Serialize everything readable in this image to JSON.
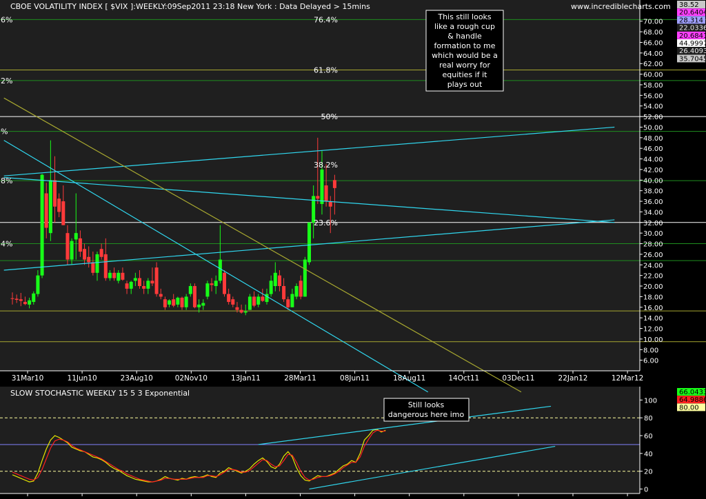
{
  "colors": {
    "background": "#000000",
    "panel": "#1f1f1f",
    "axis": "#ffffff",
    "grid": "#1f8f1f",
    "up": "#18ff18",
    "down": "#ff3a3a",
    "cyan": "#30d8f0",
    "olive": "#a8a830",
    "white_line": "#ffffff",
    "stoch_k": "#e8e800",
    "stoch_d": "#ff2020",
    "yellow_dash": "#ffffa0",
    "purple_line": "#8080ff"
  },
  "header": {
    "title": "CBOE VOLATILITY INDEX [ $VIX ]:WEEKLY:09Sep2011 23:18 New York  : Data Delayed > 15mins",
    "website": "www.incrediblecharts.com"
  },
  "price_badges": [
    {
      "text": "38.52",
      "bg": "#c8c8c8",
      "fg": "#000000"
    },
    {
      "text": "20.6404",
      "bg": "#ff40ff",
      "fg": "#000000"
    },
    {
      "text": "28.314",
      "bg": "#a0a0ff",
      "fg": "#000000"
    },
    {
      "text": "22.0336",
      "bg": "#1f1f1f",
      "fg": "#e8e8e8"
    },
    {
      "text": "20.6841",
      "bg": "#ff40ff",
      "fg": "#000000"
    },
    {
      "text": "44.9997",
      "bg": "#ffffff",
      "fg": "#000000"
    },
    {
      "text": "26.4093",
      "bg": "#1f1f1f",
      "fg": "#e8e8e8"
    },
    {
      "text": "35.7045",
      "bg": "#c8c8c8",
      "fg": "#000000"
    }
  ],
  "stoch_badges": [
    {
      "text": "66.0433",
      "bg": "#18ff18",
      "fg": "#000000"
    },
    {
      "text": "64.9886",
      "bg": "#ff2020",
      "fg": "#000000"
    },
    {
      "text": "80.00",
      "bg": "#ffffa0",
      "fg": "#000000"
    }
  ],
  "left_edge_labels": [
    {
      "text": "6%",
      "value": 70.3
    },
    {
      "text": "2%",
      "value": 58.8
    },
    {
      "text": "%",
      "value": 49.2
    },
    {
      "text": "8%",
      "value": 39.9
    },
    {
      "text": "4%",
      "value": 28.0
    }
  ],
  "annotations": {
    "cup_handle": [
      "This still looks",
      "like a rough cup",
      "& handle",
      "formation to me",
      "which would be a",
      "real worry for",
      "equities if it",
      "plays out"
    ],
    "dangerous": [
      "Still looks",
      "dangerous here imo"
    ]
  },
  "chart_data": [
    {
      "type": "candlestick",
      "title": "CBOE VOLATILITY INDEX [ $VIX ]:WEEKLY:09Sep2011 23:18 New York  : Data Delayed > 15mins",
      "ylim": [
        4,
        74
      ],
      "y_ticks": [
        6,
        8,
        10,
        12,
        14,
        16,
        18,
        20,
        22,
        24,
        26,
        28,
        30,
        32,
        34,
        36,
        38,
        40,
        42,
        44,
        46,
        48,
        50,
        52,
        54,
        56,
        58,
        60,
        62,
        64,
        66,
        68,
        70
      ],
      "x_ticks": [
        "31Mar10",
        "11Jun10",
        "23Aug10",
        "02Nov10",
        "13Jan11",
        "28Mar11",
        "08Jun11",
        "18Aug11",
        "14Oct11",
        "03Dec11",
        "22Jan12",
        "12Mar12"
      ],
      "fib_levels": [
        {
          "label": "76.4%",
          "value": 70.3
        },
        {
          "label": "61.8%",
          "value": 60.8
        },
        {
          "label": "50%",
          "value": 52.0
        },
        {
          "label": "38.2%",
          "value": 42.9
        },
        {
          "label": "23.6%",
          "value": 32.0
        }
      ],
      "horizontal_lines": [
        {
          "value": 70.3,
          "color": "grid"
        },
        {
          "value": 58.8,
          "color": "grid"
        },
        {
          "value": 49.2,
          "color": "grid"
        },
        {
          "value": 39.9,
          "color": "grid"
        },
        {
          "value": 28.0,
          "color": "grid"
        },
        {
          "value": 24.8,
          "color": "grid"
        },
        {
          "value": 15.3,
          "color": "olive"
        },
        {
          "value": 9.5,
          "color": "olive"
        },
        {
          "value": 60.8,
          "color": "olive"
        },
        {
          "value": 52.0,
          "color": "white_line"
        },
        {
          "value": 32.0,
          "color": "white_line"
        }
      ],
      "candles": [
        {
          "o": 17.7,
          "h": 18.8,
          "l": 16.5,
          "c": 17.6
        },
        {
          "o": 17.6,
          "h": 18.4,
          "l": 16.8,
          "c": 17.4
        },
        {
          "o": 17.5,
          "h": 18.7,
          "l": 16.2,
          "c": 17.2
        },
        {
          "o": 17.0,
          "h": 18.0,
          "l": 16.4,
          "c": 16.6
        },
        {
          "o": 16.5,
          "h": 17.8,
          "l": 15.8,
          "c": 17.3
        },
        {
          "o": 17.0,
          "h": 19.0,
          "l": 16.5,
          "c": 18.6
        },
        {
          "o": 18.5,
          "h": 23.0,
          "l": 18.0,
          "c": 22.0
        },
        {
          "o": 22.0,
          "h": 41.2,
          "l": 21.5,
          "c": 41.0
        },
        {
          "o": 37.5,
          "h": 39.5,
          "l": 29.0,
          "c": 31.0
        },
        {
          "o": 30.0,
          "h": 47.5,
          "l": 28.5,
          "c": 40.0
        },
        {
          "o": 40.0,
          "h": 44.5,
          "l": 32.0,
          "c": 35.0
        },
        {
          "o": 36.5,
          "h": 37.5,
          "l": 33.0,
          "c": 34.0
        },
        {
          "o": 36.0,
          "h": 39.0,
          "l": 31.5,
          "c": 31.5
        },
        {
          "o": 30.0,
          "h": 31.5,
          "l": 24.0,
          "c": 25.0
        },
        {
          "o": 25.0,
          "h": 29.0,
          "l": 24.0,
          "c": 28.5
        },
        {
          "o": 28.8,
          "h": 37.5,
          "l": 25.0,
          "c": 30.0
        },
        {
          "o": 29.0,
          "h": 30.5,
          "l": 25.5,
          "c": 26.5
        },
        {
          "o": 27.0,
          "h": 28.0,
          "l": 24.0,
          "c": 25.0
        },
        {
          "o": 25.5,
          "h": 27.5,
          "l": 23.5,
          "c": 24.5
        },
        {
          "o": 24.5,
          "h": 26.5,
          "l": 22.0,
          "c": 22.5
        },
        {
          "o": 22.5,
          "h": 26.5,
          "l": 21.0,
          "c": 26.0
        },
        {
          "o": 27.0,
          "h": 28.0,
          "l": 25.0,
          "c": 25.5
        },
        {
          "o": 26.0,
          "h": 29.0,
          "l": 21.0,
          "c": 21.5
        },
        {
          "o": 21.5,
          "h": 23.0,
          "l": 21.0,
          "c": 22.5
        },
        {
          "o": 22.5,
          "h": 23.5,
          "l": 21.0,
          "c": 21.5
        },
        {
          "o": 21.0,
          "h": 23.0,
          "l": 20.5,
          "c": 22.5
        },
        {
          "o": 22.5,
          "h": 23.5,
          "l": 21.0,
          "c": 21.2
        },
        {
          "o": 20.5,
          "h": 21.0,
          "l": 18.5,
          "c": 19.5
        },
        {
          "o": 19.5,
          "h": 21.0,
          "l": 18.5,
          "c": 20.8
        },
        {
          "o": 21.0,
          "h": 22.5,
          "l": 20.0,
          "c": 21.5
        },
        {
          "o": 21.5,
          "h": 23.0,
          "l": 19.5,
          "c": 20.0
        },
        {
          "o": 20.0,
          "h": 21.0,
          "l": 18.5,
          "c": 19.5
        },
        {
          "o": 19.5,
          "h": 21.5,
          "l": 18.5,
          "c": 21.0
        },
        {
          "o": 21.0,
          "h": 23.5,
          "l": 20.0,
          "c": 20.5
        },
        {
          "o": 23.5,
          "h": 24.5,
          "l": 18.0,
          "c": 18.5
        },
        {
          "o": 18.5,
          "h": 19.5,
          "l": 17.5,
          "c": 18.0
        },
        {
          "o": 17.5,
          "h": 18.0,
          "l": 15.5,
          "c": 16.0
        },
        {
          "o": 16.5,
          "h": 17.5,
          "l": 16.0,
          "c": 17.3
        },
        {
          "o": 17.5,
          "h": 18.5,
          "l": 16.0,
          "c": 16.3
        },
        {
          "o": 16.5,
          "h": 18.0,
          "l": 16.0,
          "c": 17.8
        },
        {
          "o": 17.8,
          "h": 18.0,
          "l": 15.5,
          "c": 16.0
        },
        {
          "o": 16.0,
          "h": 18.5,
          "l": 15.5,
          "c": 18.0
        },
        {
          "o": 18.5,
          "h": 20.5,
          "l": 18.0,
          "c": 20.0
        },
        {
          "o": 20.0,
          "h": 20.5,
          "l": 15.8,
          "c": 16.0
        },
        {
          "o": 16.0,
          "h": 17.5,
          "l": 15.0,
          "c": 16.5
        },
        {
          "o": 16.3,
          "h": 17.5,
          "l": 15.5,
          "c": 16.8
        },
        {
          "o": 18.0,
          "h": 21.0,
          "l": 17.5,
          "c": 20.5
        },
        {
          "o": 20.5,
          "h": 21.5,
          "l": 19.0,
          "c": 20.2
        },
        {
          "o": 20.0,
          "h": 22.0,
          "l": 18.5,
          "c": 21.0
        },
        {
          "o": 21.0,
          "h": 31.5,
          "l": 20.5,
          "c": 25.0
        },
        {
          "o": 22.5,
          "h": 23.0,
          "l": 18.0,
          "c": 18.5
        },
        {
          "o": 18.5,
          "h": 19.5,
          "l": 16.5,
          "c": 17.0
        },
        {
          "o": 17.5,
          "h": 18.0,
          "l": 16.0,
          "c": 16.5
        },
        {
          "o": 16.0,
          "h": 17.0,
          "l": 15.0,
          "c": 15.5
        },
        {
          "o": 15.5,
          "h": 16.5,
          "l": 14.8,
          "c": 15.0
        },
        {
          "o": 15.0,
          "h": 16.5,
          "l": 14.5,
          "c": 15.2
        },
        {
          "o": 15.5,
          "h": 18.5,
          "l": 15.5,
          "c": 18.0
        },
        {
          "o": 18.0,
          "h": 19.0,
          "l": 16.0,
          "c": 16.3
        },
        {
          "o": 16.5,
          "h": 18.5,
          "l": 16.0,
          "c": 18.0
        },
        {
          "o": 18.0,
          "h": 19.5,
          "l": 17.0,
          "c": 17.2
        },
        {
          "o": 17.0,
          "h": 19.5,
          "l": 16.5,
          "c": 18.5
        },
        {
          "o": 18.5,
          "h": 22.0,
          "l": 18.0,
          "c": 21.0
        },
        {
          "o": 20.0,
          "h": 24.5,
          "l": 19.0,
          "c": 22.5
        },
        {
          "o": 22.0,
          "h": 23.0,
          "l": 19.0,
          "c": 20.0
        },
        {
          "o": 20.0,
          "h": 21.5,
          "l": 17.0,
          "c": 17.5
        },
        {
          "o": 17.5,
          "h": 18.0,
          "l": 15.5,
          "c": 16.0
        },
        {
          "o": 16.0,
          "h": 19.5,
          "l": 16.0,
          "c": 18.5
        },
        {
          "o": 18.0,
          "h": 20.5,
          "l": 17.5,
          "c": 20.0
        },
        {
          "o": 21.0,
          "h": 22.0,
          "l": 17.5,
          "c": 18.0
        },
        {
          "o": 18.0,
          "h": 25.5,
          "l": 18.0,
          "c": 25.0
        },
        {
          "o": 24.5,
          "h": 32.0,
          "l": 24.0,
          "c": 32.0
        },
        {
          "o": 32.0,
          "h": 39.0,
          "l": 29.0,
          "c": 37.0
        },
        {
          "o": 37.0,
          "h": 48.0,
          "l": 35.5,
          "c": 36.5
        },
        {
          "o": 35.5,
          "h": 45.5,
          "l": 33.5,
          "c": 42.0
        },
        {
          "o": 39.0,
          "h": 43.0,
          "l": 35.0,
          "c": 36.0
        },
        {
          "o": 36.0,
          "h": 37.0,
          "l": 30.0,
          "c": 35.0
        },
        {
          "o": 40.0,
          "h": 41.0,
          "l": 33.5,
          "c": 38.5
        }
      ],
      "trendlines": [
        {
          "color": "cyan",
          "from": {
            "i": -2,
            "v": 40.5
          },
          "to": {
            "i": 142,
            "v": 32.0
          },
          "note": "upper cyan through lows"
        },
        {
          "color": "cyan",
          "from": {
            "i": -2,
            "v": 23.0
          },
          "to": {
            "i": 142,
            "v": 32.5
          }
        },
        {
          "color": "cyan",
          "from": {
            "i": -2,
            "v": 40.8
          },
          "to": {
            "i": 142,
            "v": 50.0
          }
        },
        {
          "color": "cyan",
          "from": {
            "i": -2,
            "v": 47.5
          },
          "to": {
            "i": 98,
            "v": 0.0
          }
        },
        {
          "color": "olive",
          "from": {
            "i": -2,
            "v": 55.5
          },
          "to": {
            "i": 120,
            "v": 0.0
          }
        }
      ]
    },
    {
      "type": "line",
      "title": "SLOW STOCHASTIC WEEKLY 15 5 3 Exponential",
      "ylim": [
        -5,
        115
      ],
      "y_ticks": [
        0,
        20,
        40,
        60,
        80,
        100
      ],
      "levels": [
        {
          "value": 80,
          "color": "yellow_dash"
        },
        {
          "value": 50,
          "color": "purple_line"
        },
        {
          "value": 20,
          "color": "yellow_dash"
        }
      ],
      "series": [
        {
          "color": "stoch_k",
          "values": [
            16,
            14,
            12,
            10,
            8,
            9,
            18,
            32,
            45,
            55,
            60,
            58,
            55,
            52,
            47,
            45,
            43,
            42,
            39,
            36,
            35,
            33,
            30,
            26,
            23,
            21,
            18,
            15,
            13,
            11,
            10,
            9,
            8,
            8,
            9,
            11,
            14,
            12,
            11,
            10,
            12,
            11,
            13,
            14,
            13,
            14,
            16,
            14,
            13,
            18,
            20,
            24,
            22,
            20,
            18,
            20,
            23,
            28,
            32,
            35,
            31,
            25,
            23,
            28,
            37,
            42,
            36,
            24,
            15,
            10,
            9,
            12,
            15,
            14,
            14,
            16,
            18,
            22,
            26,
            28,
            32,
            30,
            40,
            55,
            60,
            66,
            67,
            64,
            66
          ]
        },
        {
          "color": "stoch_d",
          "values": [
            19,
            17,
            15,
            13,
            11,
            10,
            13,
            22,
            34,
            46,
            54,
            56,
            55,
            53,
            49,
            46,
            44,
            42,
            40,
            38,
            36,
            34,
            31,
            28,
            25,
            22,
            20,
            17,
            15,
            13,
            11,
            10,
            9,
            8,
            9,
            10,
            12,
            12,
            11,
            11,
            11,
            11,
            12,
            13,
            13,
            13,
            15,
            15,
            14,
            16,
            19,
            22,
            22,
            21,
            19,
            19,
            21,
            25,
            29,
            33,
            32,
            28,
            25,
            26,
            32,
            39,
            38,
            30,
            20,
            13,
            10,
            11,
            13,
            14,
            14,
            15,
            17,
            20,
            24,
            27,
            30,
            30,
            36,
            48,
            56,
            63,
            66,
            65,
            65
          ]
        }
      ],
      "trendlines": [
        {
          "color": "cyan",
          "from": {
            "i": 58,
            "v": 50
          },
          "to": {
            "i": 127,
            "v": 93
          }
        },
        {
          "color": "cyan",
          "from": {
            "i": 70,
            "v": 0
          },
          "to": {
            "i": 128,
            "v": 48
          }
        }
      ]
    }
  ]
}
